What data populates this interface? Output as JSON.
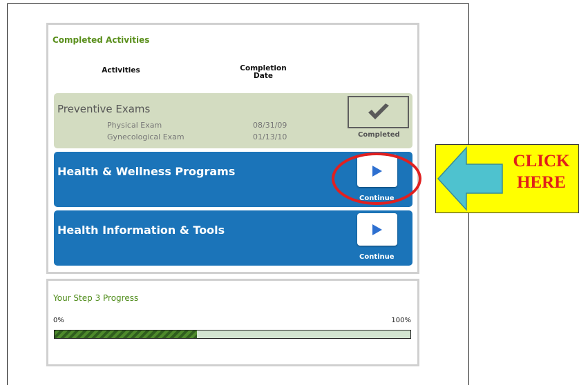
{
  "completed_panel": {
    "title": "Completed Activities",
    "col_activities": "Activities",
    "col_completion_line1": "Completion",
    "col_completion_line2": "Date"
  },
  "preventive": {
    "title": "Preventive Exams",
    "status": "Completed",
    "items": [
      {
        "name": "Physical Exam",
        "date": "08/31/09"
      },
      {
        "name": "Gynecological Exam",
        "date": "01/13/10"
      }
    ]
  },
  "programs": [
    {
      "title": "Health & Wellness Programs",
      "button": "Continue"
    },
    {
      "title": "Health Information & Tools",
      "button": "Continue"
    }
  ],
  "progress": {
    "title": "Your Step 3 Progress",
    "min_label": "0%",
    "max_label": "100%",
    "value": 0.4
  },
  "callout": {
    "line1": "CLICK",
    "line2": "HERE"
  },
  "colors": {
    "accent_green": "#5a8f1c",
    "card_blue": "#1b74b9",
    "callout_yellow": "#ffff00",
    "highlight_red": "#e02020"
  },
  "icons": {
    "check": "check-icon",
    "play": "play-icon",
    "arrow": "left-arrow-icon"
  }
}
